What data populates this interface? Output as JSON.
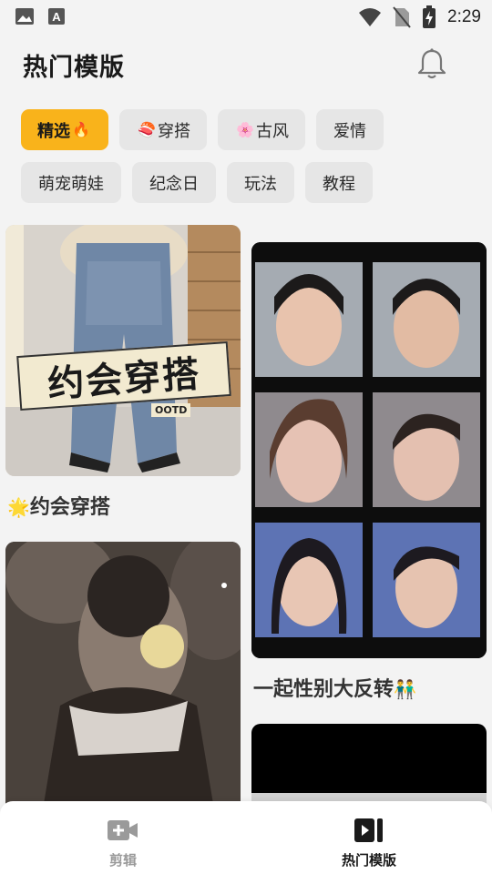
{
  "status_bar": {
    "time": "2:29",
    "icons": [
      "image-icon",
      "font-icon",
      "wifi-icon",
      "no-sim-icon",
      "battery-charging-icon"
    ]
  },
  "header": {
    "title": "热门模版",
    "bell_icon": "bell-icon"
  },
  "chips": [
    {
      "label": "精选",
      "emoji": "🔥",
      "emoji_pos": "after",
      "active": true
    },
    {
      "label": "穿搭",
      "emoji": "🍣",
      "emoji_pos": "before",
      "active": false
    },
    {
      "label": "古风",
      "emoji": "🌸",
      "emoji_pos": "before",
      "active": false
    },
    {
      "label": "爱情",
      "emoji": "",
      "active": false
    },
    {
      "label": "萌宠萌娃",
      "emoji": "",
      "active": false
    },
    {
      "label": "纪念日",
      "emoji": "",
      "active": false
    },
    {
      "label": "玩法",
      "emoji": "",
      "active": false
    },
    {
      "label": "教程",
      "emoji": "",
      "active": false
    }
  ],
  "feed": {
    "cards": [
      {
        "title_emoji": "🌟",
        "title": "约会穿搭",
        "overlay_text": "约会穿搭",
        "overlay_sub": "OOTD"
      },
      {
        "title": "一起性别大反转",
        "title_emoji": "👬"
      },
      {
        "title": ""
      },
      {
        "title": ""
      }
    ]
  },
  "bottom_nav": {
    "items": [
      {
        "label": "剪辑",
        "icon": "video-add-icon",
        "active": false
      },
      {
        "label": "热门模版",
        "icon": "template-icon",
        "active": true
      }
    ]
  },
  "colors": {
    "accent": "#f9b31b",
    "background": "#f3f3f3",
    "chip_bg": "#e6e6e6",
    "nav_inactive": "#9a9a9a"
  }
}
